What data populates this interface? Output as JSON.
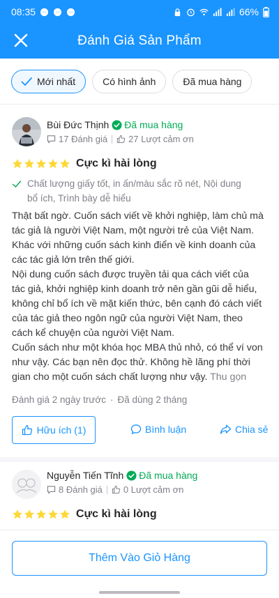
{
  "status_bar": {
    "time": "08:35",
    "battery": "66%"
  },
  "header": {
    "title": "Đánh Giá Sản Phẩm"
  },
  "filters": [
    {
      "label": "Mới nhất",
      "active": true
    },
    {
      "label": "Có hình ảnh",
      "active": false
    },
    {
      "label": "Đã mua hàng",
      "active": false
    }
  ],
  "reviews": [
    {
      "name": "Bùi Đức Thịnh",
      "verified_label": "Đã mua hàng",
      "review_count": "17 Đánh giá",
      "thanks_count": "27 Lượt cảm ơn",
      "rating": 5,
      "rating_title": "Cực kì hài lòng",
      "attributes_line1": "Chất lượng giấy tốt, in ấn/màu sắc rõ nét, Nội dung",
      "attributes_line2": "bổ ích, Trình bày dễ hiểu",
      "content_lines": [
        "Thật bất ngờ. Cuốn sách viết về khởi nghiệp, làm chủ mà",
        "tác giả là người Việt Nam, một người trẻ của Việt Nam.",
        "Khác với những cuốn sách kinh điển về kinh doanh của",
        "các tác giả lớn trên thế giới.",
        "Nội dung cuốn sách được truyền tải qua cách viết của",
        "tác giả, khởi nghiệp kinh doanh trở nên gần gũi dễ hiểu,",
        "không chỉ bổ ích về mặt kiến thức, bên cạnh đó cách viết",
        "của tác giả theo ngôn ngữ của người Việt Nam, theo",
        "cách kể chuyện của người Việt Nam.",
        "Cuốn sách như một khóa học MBA thủ nhỏ, có thể ví von",
        "như vậy. Các bạn nên đọc thử. Không hề lãng phí thời",
        "gian cho một cuốn sách chất lượng như vậy."
      ],
      "collapse_label": "Thu gọn",
      "reviewed_ago": "Đánh giá 2 ngày trước",
      "used_for": "Đã dùng 2 tháng",
      "helpful_label": "Hữu ích (1)",
      "comment_label": "Bình luận",
      "share_label": "Chia sẻ"
    },
    {
      "name": "Nguyễn Tiến Tĩnh",
      "verified_label": "Đã mua hàng",
      "review_count": "8 Đánh giá",
      "thanks_count": "0 Lượt cảm ơn",
      "rating": 5,
      "rating_title": "Cực kì hài lòng"
    }
  ],
  "footer": {
    "add_to_cart_label": "Thêm Vào Giỏ Hàng"
  },
  "colors": {
    "primary": "#1a94ff",
    "verified_green": "#00ab56",
    "star": "#fdd836"
  }
}
